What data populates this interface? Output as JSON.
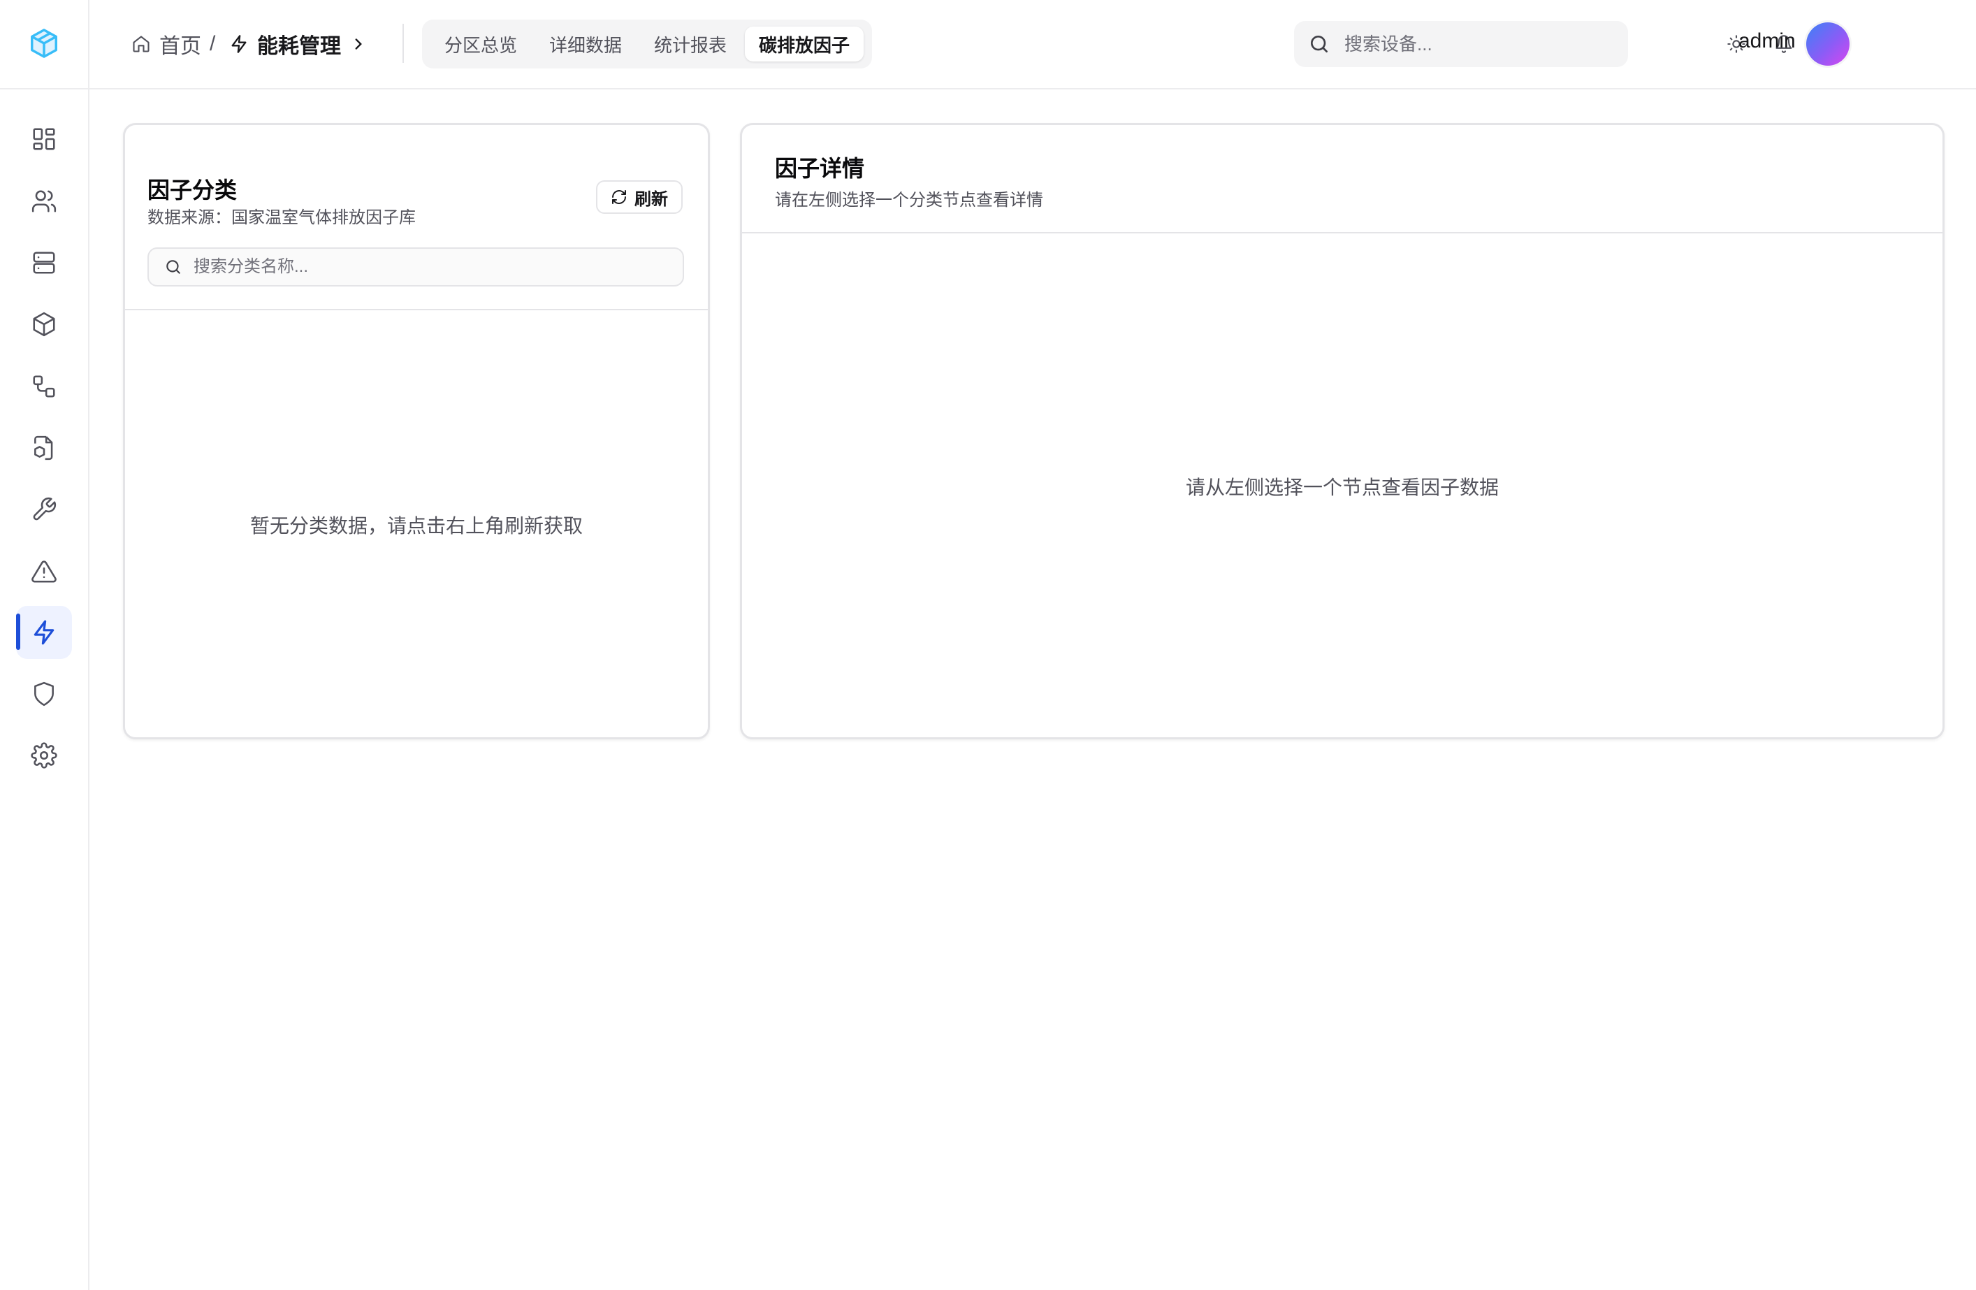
{
  "breadcrumb": {
    "home_label": "首页",
    "separator": "/",
    "current_label": "能耗管理"
  },
  "tabs": [
    {
      "label": "分区总览",
      "active": false
    },
    {
      "label": "详细数据",
      "active": false
    },
    {
      "label": "统计报表",
      "active": false
    },
    {
      "label": "碳排放因子",
      "active": true
    }
  ],
  "header": {
    "search_placeholder": "搜索设备...",
    "username": "admin"
  },
  "sidebar": {
    "items": [
      {
        "icon": "dashboard-icon",
        "active": false
      },
      {
        "icon": "users-icon",
        "active": false
      },
      {
        "icon": "server-icon",
        "active": false
      },
      {
        "icon": "cube-icon",
        "active": false
      },
      {
        "icon": "workflow-icon",
        "active": false
      },
      {
        "icon": "file-box-icon",
        "active": false
      },
      {
        "icon": "wrench-icon",
        "active": false
      },
      {
        "icon": "alert-triangle-icon",
        "active": false
      },
      {
        "icon": "zap-icon",
        "active": true
      },
      {
        "icon": "shield-icon",
        "active": false
      },
      {
        "icon": "settings-icon",
        "active": false
      }
    ]
  },
  "left_panel": {
    "title": "因子分类",
    "subtitle": "数据来源：国家温室气体排放因子库",
    "refresh_label": "刷新",
    "search_placeholder": "搜索分类名称...",
    "empty_message": "暂无分类数据，请点击右上角刷新获取"
  },
  "right_panel": {
    "title": "因子详情",
    "subtitle": "请在左侧选择一个分类节点查看详情",
    "empty_message": "请从左侧选择一个节点查看因子数据"
  },
  "colors": {
    "accent": "#1d4ed8",
    "logo": "#38bdf8",
    "border": "#e4e4e7"
  }
}
